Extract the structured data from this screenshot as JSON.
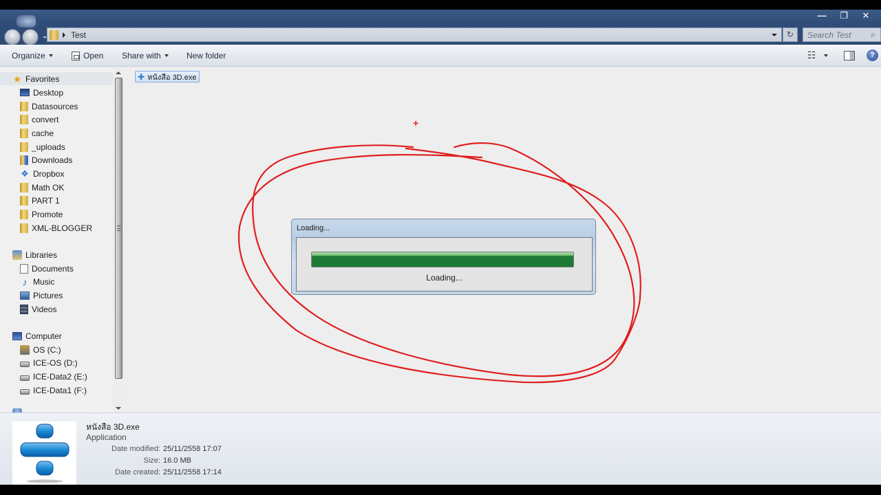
{
  "window": {
    "controls": {
      "minimize": "—",
      "restore": "❐",
      "close": "✕"
    }
  },
  "address_bar": {
    "crumbs": [
      "Test"
    ],
    "refresh_glyph": "↻"
  },
  "search": {
    "placeholder": "Search Test",
    "icon": "⌕"
  },
  "toolbar": {
    "organize": "Organize",
    "open": "Open",
    "share_with": "Share with",
    "new_folder": "New folder",
    "views_glyph": "☷",
    "help_glyph": "?"
  },
  "sidebar": {
    "favorites": {
      "label": "Favorites",
      "items": [
        {
          "label": "Desktop",
          "icon": "desktop-icon"
        },
        {
          "label": "Datasources",
          "icon": "folder-icon"
        },
        {
          "label": "convert",
          "icon": "folder-icon"
        },
        {
          "label": "cache",
          "icon": "folder-icon"
        },
        {
          "label": "_uploads",
          "icon": "folder-icon"
        },
        {
          "label": "Downloads",
          "icon": "downloads-folder-icon"
        },
        {
          "label": "Dropbox",
          "icon": "dropbox-icon"
        },
        {
          "label": "Math OK",
          "icon": "folder-icon"
        },
        {
          "label": "PART 1",
          "icon": "folder-icon"
        },
        {
          "label": "Promote",
          "icon": "folder-icon"
        },
        {
          "label": "XML-BLOGGER",
          "icon": "folder-icon"
        }
      ]
    },
    "libraries": {
      "label": "Libraries",
      "items": [
        {
          "label": "Documents",
          "icon": "documents-icon"
        },
        {
          "label": "Music",
          "icon": "music-icon"
        },
        {
          "label": "Pictures",
          "icon": "pictures-icon"
        },
        {
          "label": "Videos",
          "icon": "videos-icon"
        }
      ]
    },
    "computer": {
      "label": "Computer",
      "items": [
        {
          "label": "OS (C:)",
          "icon": "system-drive-icon"
        },
        {
          "label": "ICE-OS (D:)",
          "icon": "drive-icon"
        },
        {
          "label": "ICE-Data2 (E:)",
          "icon": "drive-icon"
        },
        {
          "label": "ICE-Data1 (F:)",
          "icon": "drive-icon"
        }
      ]
    }
  },
  "files": [
    {
      "name": "หนังสือ 3D.exe",
      "selected": true
    }
  ],
  "loading_dialog": {
    "title": "Loading...",
    "status": "Loading...",
    "progress_percent": 100,
    "accent": "#1b7a35"
  },
  "annotation": {
    "color": "#e01e1e",
    "cursor_glyph": "+"
  },
  "details_pane": {
    "name": "หนังสือ 3D.exe",
    "type": "Application",
    "rows": [
      {
        "label": "Date modified:",
        "value": "25/11/2558 17:07"
      },
      {
        "label": "Size:",
        "value": "16.0 MB"
      },
      {
        "label": "Date created:",
        "value": "25/11/2558 17:14"
      }
    ]
  }
}
